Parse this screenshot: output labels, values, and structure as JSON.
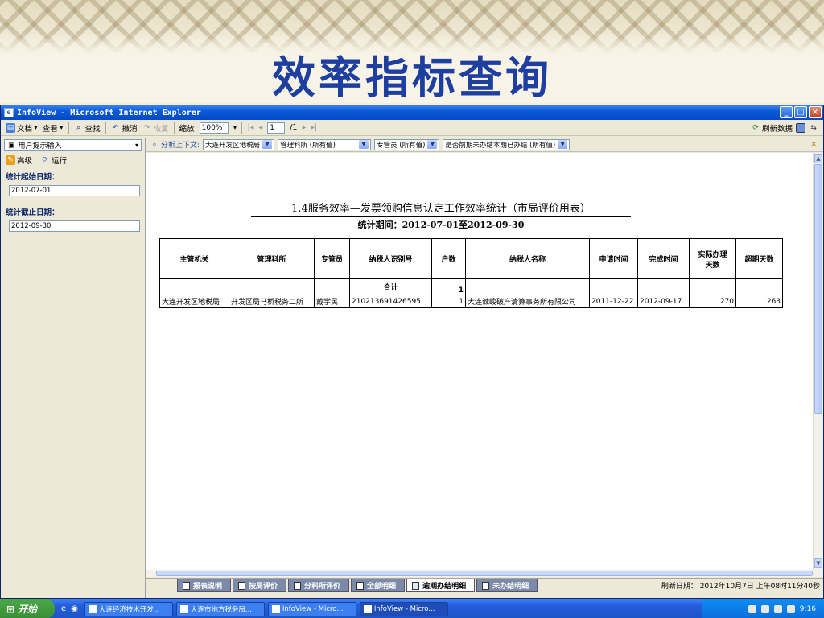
{
  "slide": {
    "title": "效率指标查询"
  },
  "window": {
    "title": "InfoView - Microsoft Internet Explorer",
    "controls": {
      "minimize": "_",
      "maximize": "□",
      "close": "×"
    }
  },
  "toolbar": {
    "document": "文档",
    "view": "查看",
    "find": "查找",
    "undo": "撤消",
    "redo": "恢复",
    "zoom_label": "缩放",
    "zoom_value": "100%",
    "page_current": "1",
    "page_total": "/1",
    "refresh_data": "刷新数据"
  },
  "left_panel": {
    "dropdown": "用户提示输入",
    "advanced": "高级",
    "run": "运行",
    "start_label": "统计起始日期：",
    "start_value": "2012-07-01",
    "end_label": "统计截止日期：",
    "end_value": "2012-09-30"
  },
  "filters": {
    "context_label": "分析上下文:",
    "items": [
      "大连开发区地税局",
      "管理科所 (所有值)",
      "专管员 (所有值)",
      "是否前期未办结本期已办结 (所有值)"
    ]
  },
  "report": {
    "title": "1.4服务效率—发票领购信息认定工作效率统计（市局评价用表）",
    "subtitle": "统计期间：2012-07-01至2012-09-30",
    "headers": [
      "主管机关",
      "管理科所",
      "专管员",
      "纳税人识别号",
      "户数",
      "纳税人名称",
      "申请时间",
      "完成时间",
      "实际办理天数",
      "超期天数"
    ],
    "total_label": "合计",
    "total_count": "1",
    "rows": [
      [
        "大连开发区地税局",
        "开发区局马桥税务二所",
        "戴学民",
        "210213691426595",
        "1",
        "大连诚峻破产清算事务所有限公司",
        "2011-12-22",
        "2012-09-17",
        "270",
        "263"
      ]
    ]
  },
  "tabs": [
    {
      "label": "报表说明",
      "active": false
    },
    {
      "label": "按局评价",
      "active": false
    },
    {
      "label": "分科所评价",
      "active": false
    },
    {
      "label": "全部明细",
      "active": false
    },
    {
      "label": "逾期办结明细",
      "active": true
    },
    {
      "label": "未办结明细",
      "active": false
    }
  ],
  "status": {
    "refresh": "刷新日期：  2012年10月7日 上午08时11分40秒"
  },
  "taskbar": {
    "start": "开始",
    "tasks": [
      "大连经济技术开发...",
      "大连市地方税务局...",
      "InfoView - Micro...",
      "InfoView - Micro..."
    ],
    "time": "9:16"
  },
  "colors": {
    "title_blue": "#1f3fa0",
    "xp_blue": "#245edb",
    "start_green": "#3a8f36"
  }
}
